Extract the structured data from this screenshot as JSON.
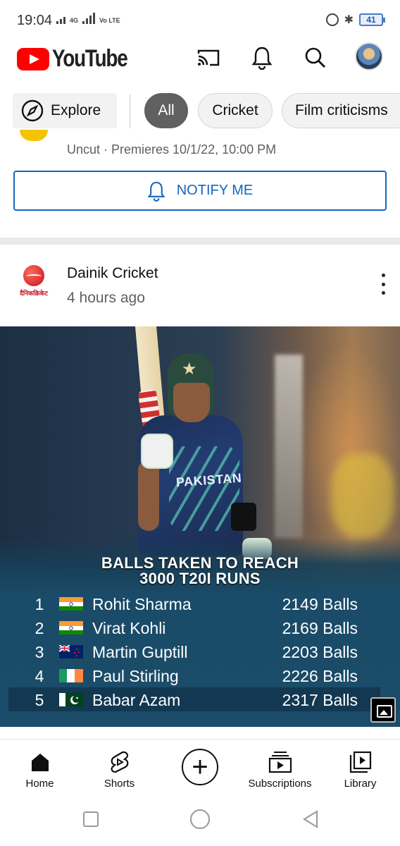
{
  "status_bar": {
    "time": "19:04",
    "net1": "4G",
    "net2": "Vo LTE",
    "battery": "41"
  },
  "header": {
    "logo_text": "YouTube",
    "icons": [
      "cast-icon",
      "notifications-icon",
      "search-icon",
      "avatar"
    ]
  },
  "chips": {
    "explore": "Explore",
    "items": [
      "All",
      "Cricket",
      "Film criticisms"
    ],
    "selected": "All"
  },
  "premiere": {
    "meta": "Uncut · Premieres 10/1/22, 10:00 PM",
    "notify_label": "NOTIFY ME"
  },
  "post": {
    "channel_logo_text": "दैनिकक्रिकेट",
    "channel": "Dainik Cricket",
    "time": "4 hours ago",
    "image": {
      "jersey_text": "PAKISTAN",
      "title_line1": "BALLS TAKEN TO REACH",
      "title_line2": "3000 T20I RUNS",
      "rows": [
        {
          "rank": "1",
          "flag": "india",
          "name": "Rohit Sharma",
          "balls": "2149 Balls"
        },
        {
          "rank": "2",
          "flag": "india",
          "name": "Virat Kohli",
          "balls": "2169 Balls"
        },
        {
          "rank": "3",
          "flag": "new-zealand",
          "name": "Martin Guptill",
          "balls": "2203 Balls"
        },
        {
          "rank": "4",
          "flag": "ireland",
          "name": "Paul Stirling",
          "balls": "2226 Balls"
        },
        {
          "rank": "5",
          "flag": "pakistan",
          "name": "Babar Azam",
          "balls": "2317 Balls"
        }
      ]
    }
  },
  "bottom_nav": {
    "home": "Home",
    "shorts": "Shorts",
    "create": "+",
    "subscriptions": "Subscriptions",
    "library": "Library"
  },
  "colors": {
    "brand_red": "#ff0000",
    "link_blue": "#1565c0",
    "chip_active": "#606060"
  }
}
